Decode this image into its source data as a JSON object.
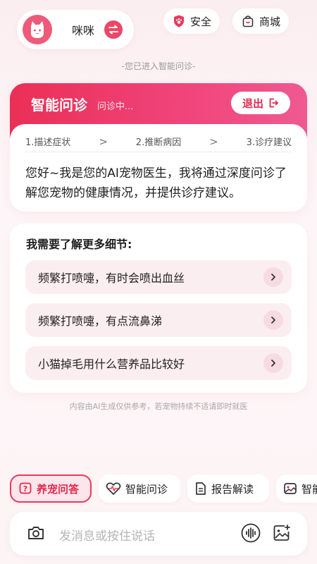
{
  "header": {
    "pet_name": "咪咪",
    "safety_label": "安全",
    "mall_label": "商城",
    "entered_notice": "-您已进入智能问诊-"
  },
  "consult": {
    "title": "智能问诊",
    "status": "问诊中...",
    "exit_label": "退出",
    "steps": [
      "1.描述症状",
      "2.推断病因",
      "3.诊疗建议"
    ],
    "greeting": "您好~我是您的AI宠物医生，我将通过深度问诊了解您宠物的健康情况，并提供诊疗建议。"
  },
  "details": {
    "title": "我需要了解更多细节:",
    "suggestions": [
      "频繁打喷嚏，有时会喷出血丝",
      "频繁打喷嚏，有点流鼻涕",
      "小猫掉毛用什么营养品比较好"
    ]
  },
  "disclaimer": "内容由AI生成仅供参考，若宠物持续不适请即时就医",
  "tabs": [
    "养宠问答",
    "智能问诊",
    "报告解读",
    "智能"
  ],
  "input": {
    "placeholder": "发消息或按住说话"
  },
  "colors": {
    "accent": "#e83a5e",
    "accent_light": "#fbeef1"
  }
}
